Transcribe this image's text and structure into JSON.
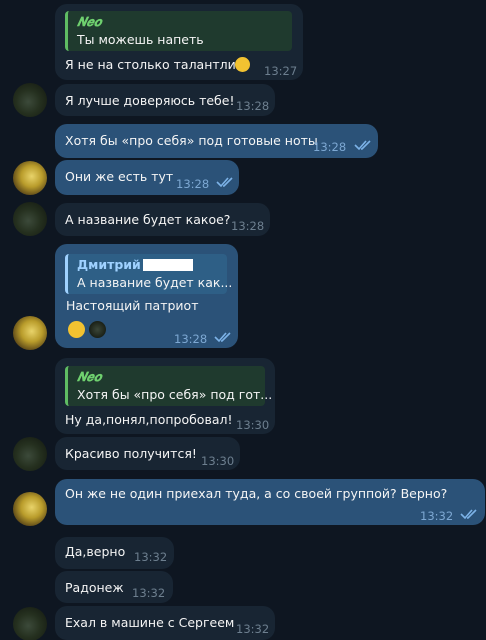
{
  "colors": {
    "background": "#0e1621",
    "incoming_bubble": "#182533",
    "outgoing_bubble": "#2b5278",
    "reply_green": "#5fbc63",
    "check_color": "#7db3e8"
  },
  "messages": [
    {
      "reply": {
        "name": "𝑵𝒆𝒐",
        "text": "Ты можешь напеть"
      },
      "text": "Я не на столько талантлив!",
      "emoji": "grinning-sweat-emoji",
      "time": "13:27"
    },
    {
      "text": "Я лучше доверяюсь тебе!",
      "time": "13:28"
    },
    {
      "text": "Хотя бы «про себя» под готовые ноты",
      "time": "13:28",
      "read": true
    },
    {
      "text": "Они же есть тут",
      "time": "13:28",
      "read": true
    },
    {
      "text": "А название будет какое?",
      "time": "13:28"
    },
    {
      "reply": {
        "name": "Дмитрий",
        "text": "А название будет как..."
      },
      "text": "Настоящий патриот",
      "reactions": [
        "thumbs-up-emoji",
        "avatar-reaction"
      ],
      "time": "13:28",
      "read": true
    },
    {
      "reply": {
        "name": "𝑵𝒆𝒐",
        "text": "Хотя бы «про себя» под гот..."
      },
      "text": "Ну да,понял,попробовал!",
      "time": "13:30"
    },
    {
      "text": "Красиво получится!",
      "time": "13:30"
    },
    {
      "text": "Он же не один приехал туда,  а со своей группой? Верно?",
      "time": "13:32",
      "read": true
    },
    {
      "text": "Да,верно",
      "time": "13:32"
    },
    {
      "text": "Радонеж",
      "time": "13:32"
    },
    {
      "text": "Ехал в машине с Сергеем",
      "time": "13:32"
    }
  ]
}
